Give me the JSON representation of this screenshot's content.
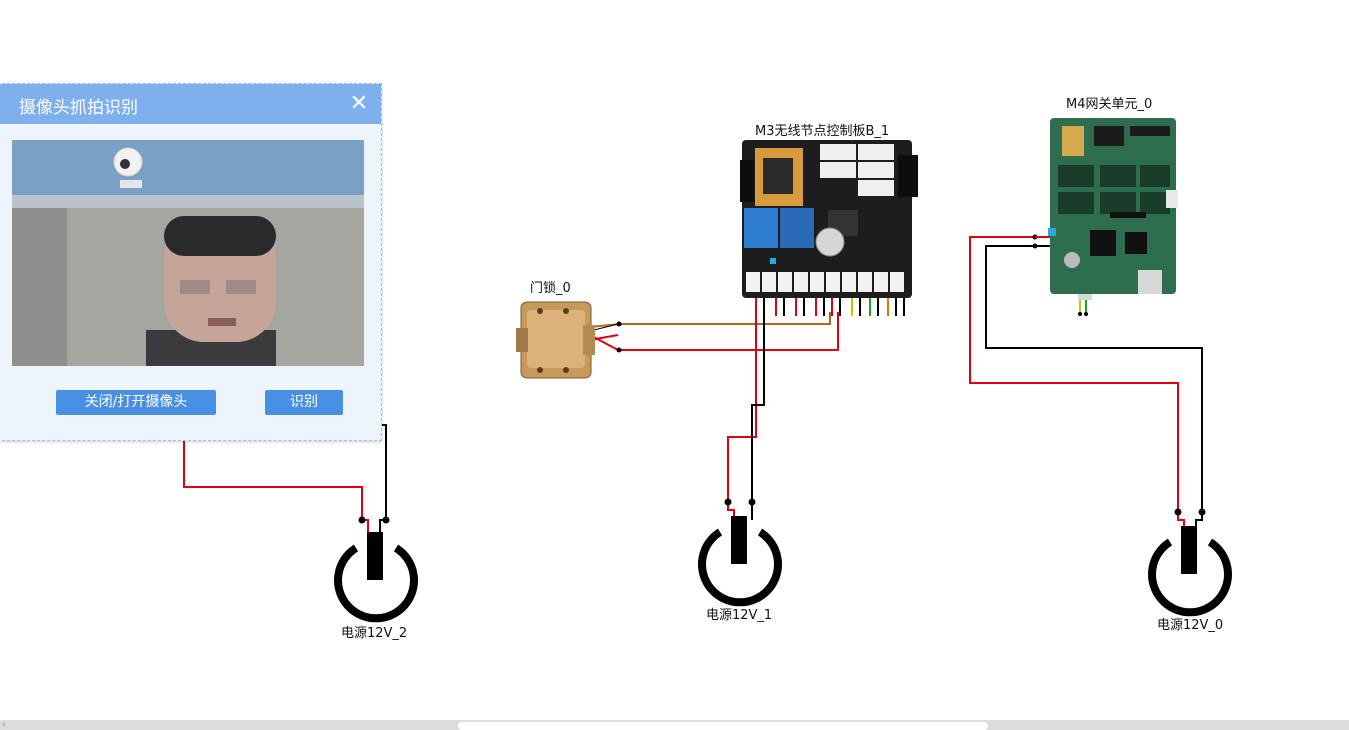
{
  "devices": {
    "door_lock": {
      "label": "门锁_0"
    },
    "m3_board": {
      "label": "M3无线节点控制板B_1"
    },
    "m4_gateway": {
      "label": "M4网关单元_0"
    },
    "power_2": {
      "label": "电源12V_2"
    },
    "power_1": {
      "label": "电源12V_1"
    },
    "power_0": {
      "label": "电源12V_0"
    }
  },
  "camera_dialog": {
    "title": "摄像头抓拍识别",
    "close_glyph": "✕",
    "toggle_label": "关闭/打开摄像头",
    "recognize_label": "识别"
  },
  "colors": {
    "wire_red": "#e0000f",
    "wire_black": "#000000",
    "wire_brown": "#b5651d",
    "dialog_header": "#7fb0ee",
    "button": "#4a90e2",
    "pcb_black": "#1d1d1f",
    "pcb_green": "#2c6e4e"
  }
}
